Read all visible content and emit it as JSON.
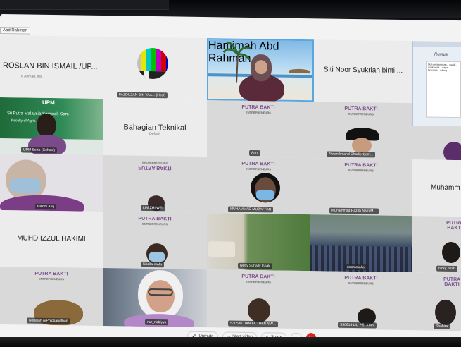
{
  "window": {
    "top_bar_items": [
      "",
      "",
      ""
    ]
  },
  "corner_tag": "Abd Rahman",
  "tiles": {
    "r1c1": {
      "name": "ROSLAN BIN ISMAIL /UP...",
      "sub": "",
      "tag": ""
    },
    "r1c2": {
      "tag": "FAZDUZAN BIN YAA... (Host)"
    },
    "self": {
      "tag": "Hamimah Abd Rahman"
    },
    "r1c4": {
      "name": "Siti Noor Syukriah binti ..."
    },
    "r2c1": {
      "tag": "UPM Serta (Cohost)",
      "banner_title": "UPM",
      "banner_sub": "Sti Putra Malaysia Sarawak Cam",
      "banner_sub2": "Faculty of Agric... Sciences"
    },
    "r2c2": {
      "name": "Bahagian Teknikal",
      "sub": "Default"
    },
    "r2c3": {
      "tag": "Anni"
    },
    "r2c4": {
      "tag": "Alwanikmand Charlie Cam..."
    },
    "r3c1": {
      "tag": "Hazim Afiq"
    },
    "r3c2": {
      "tag": "LIM ZHI WEI"
    },
    "r3c3": {
      "tag": "MUHAMMAD MUZAFFAR"
    },
    "r3c4": {
      "tag": "Muhammad Hazim Nam M..."
    },
    "r3c5": {
      "name": "Muhamm"
    },
    "r4c1": {
      "name": "MUHD IZZUL HAKIMI"
    },
    "r4c2": {
      "tag": "Naqila Wafa"
    },
    "r4c3": {
      "tag": "Netty Suhaily Ishak"
    },
    "r4c4": {
      "tag": "nooramalia"
    },
    "r4c5": {
      "tag": "nicky onsh"
    },
    "r5c1": {
      "tag": "Nobalan A/P Yoganathan"
    },
    "r5c2": {
      "tag": "nur_nabiyya"
    },
    "r5c3": {
      "tag": "S30530 DANIEL THEN SW..."
    },
    "r5c4": {
      "tag": "S30614 LIU PEI XIAN"
    },
    "r5c5": {
      "tag": "Shahira"
    }
  },
  "logo": {
    "line1": "PUTRA BAKTI",
    "line2": "ENTREPRENEURS"
  },
  "slide_text": "Dua pelajar akan... wakil... anak-anak... dapat bersama... tolong...",
  "slide_title": "Rumus",
  "toolbar": {
    "unmute": "Unmute",
    "start_video": "Start video",
    "share": "Share",
    "end": "✕"
  }
}
